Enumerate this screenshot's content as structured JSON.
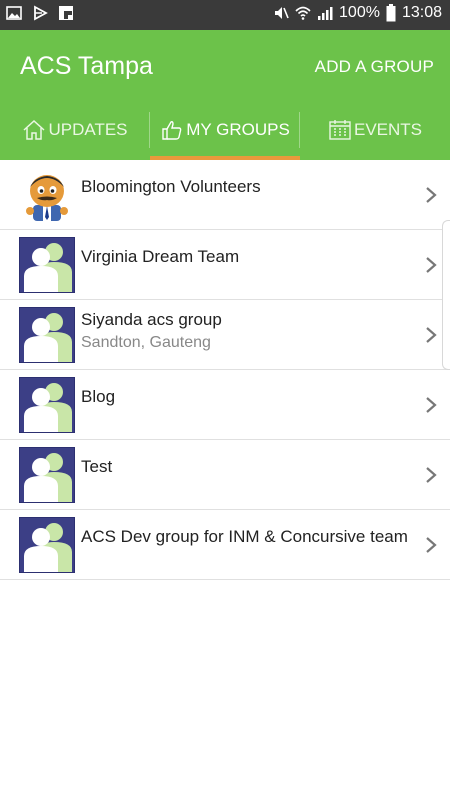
{
  "status_bar": {
    "battery": "100%",
    "time": "13:08",
    "icons": [
      "gallery-icon",
      "play-icon",
      "flipboard-icon",
      "mute-icon",
      "wifi-icon",
      "signal-icon",
      "battery-icon"
    ]
  },
  "app_bar": {
    "title": "ACS Tampa",
    "action": "ADD A GROUP"
  },
  "tabs": [
    {
      "label": "UPDATES",
      "icon": "home-icon",
      "active": false
    },
    {
      "label": "MY GROUPS",
      "icon": "thumbs-up-icon",
      "active": true
    },
    {
      "label": "EVENTS",
      "icon": "calendar-icon",
      "active": false
    }
  ],
  "groups": [
    {
      "name": "Bloomington Volunteers",
      "subtitle": "",
      "avatar": "mascot-avatar"
    },
    {
      "name": "Virginia Dream Team",
      "subtitle": "",
      "avatar": "group-avatar"
    },
    {
      "name": "Siyanda acs group",
      "subtitle": "Sandton, Gauteng",
      "avatar": "group-avatar"
    },
    {
      "name": "Blog",
      "subtitle": "",
      "avatar": "group-avatar"
    },
    {
      "name": "Test",
      "subtitle": "",
      "avatar": "group-avatar"
    },
    {
      "name": "ACS Dev group for INM & Concursive team",
      "subtitle": "",
      "avatar": "group-avatar"
    }
  ],
  "colors": {
    "status_bar": "#3a3a3a",
    "primary": "#6cc24a",
    "tab_indicator": "#e99a3c",
    "avatar_bg": "#3c3f86"
  }
}
